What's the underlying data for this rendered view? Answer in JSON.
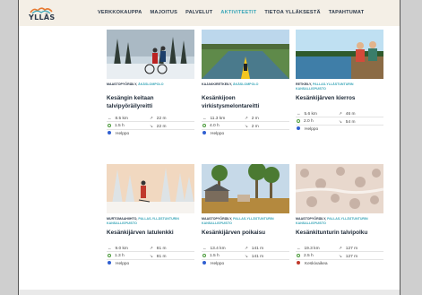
{
  "brand": {
    "name": "YLLÄS"
  },
  "nav": [
    {
      "label": "VERKKOKAUPPA",
      "active": false
    },
    {
      "label": "MAJOITUS",
      "active": false
    },
    {
      "label": "PALVELUT",
      "active": false
    },
    {
      "label": "AKTIVITEETIT",
      "active": true
    },
    {
      "label": "TIETOA YLLÄKSESTÄ",
      "active": false
    },
    {
      "label": "TAPAHTUMAT",
      "active": false
    }
  ],
  "colors": {
    "accent": "#3aa6b8",
    "easy": "#2f5fd1",
    "medium": "#c0392b",
    "header_bg": "#f4efe6"
  },
  "cards": [
    {
      "image": "winter-bikers-forest",
      "category": "MAASTOPYÖRÄILY,",
      "location": " ÄKÄSLOMPOLO",
      "title": "Kesängin keitaan talvipyöräilyreitti",
      "distance": "8.5 km",
      "ascent": "22 m",
      "duration": "1.5 h",
      "descent": "22 m",
      "difficulty": "Helppo",
      "difficulty_level": "easy"
    },
    {
      "image": "kayak-on-river",
      "category": "KAJAKKIRETKEILY,",
      "location": " ÄKÄSLOMPOLO",
      "title": "Kesänkijoen virkistysmelontareitti",
      "distance": "11.3 km",
      "ascent": "2 m",
      "duration": "4.0 h",
      "descent": "2 m",
      "difficulty": "Helppo",
      "difficulty_level": "easy"
    },
    {
      "image": "hikers-by-lake",
      "category": "RETKEILY,",
      "location": " PALLAS-YLLÄSTUNTURIN KANSALLISPUISTO",
      "title": "Kesänkijärven kierros",
      "distance": "5.6 km",
      "ascent": "46 m",
      "duration": "2.0 h",
      "descent": "54 m",
      "difficulty": "Helppo",
      "difficulty_level": "easy"
    },
    {
      "image": "skier-snowy-forest",
      "category": "MURTOMAAHIIHTO,",
      "location": " PALLAS-YLLÄSTUNTURIN KANSALLISPUISTO",
      "title": "Kesänkijärven latulenkki",
      "distance": "9.0 km",
      "ascent": "81 m",
      "duration": "1.3 h",
      "descent": "81 m",
      "difficulty": "Helppo",
      "difficulty_level": "easy"
    },
    {
      "image": "cabin-autumn-forest",
      "category": "MAASTOPYÖRÄILY,",
      "location": " PALLAS-YLLÄSTUNTURIN KANSALLISPUISTO",
      "title": "Kesänkijärven poikaisu",
      "distance": "13.4 km",
      "ascent": "141 m",
      "duration": "1.5 h",
      "descent": "141 m",
      "difficulty": "Helppo",
      "difficulty_level": "easy"
    },
    {
      "image": "aerial-snowy-trees",
      "category": "MAASTOPYÖRÄILY,",
      "location": " PALLAS-YLLÄSTUNTURIN KANSALLISPUISTO",
      "title": "Kesänkitunturin talvipolku",
      "distance": "19.3 km",
      "ascent": "127 m",
      "duration": "2.5 h",
      "descent": "127 m",
      "difficulty": "Keskivaikea",
      "difficulty_level": "medium"
    }
  ]
}
